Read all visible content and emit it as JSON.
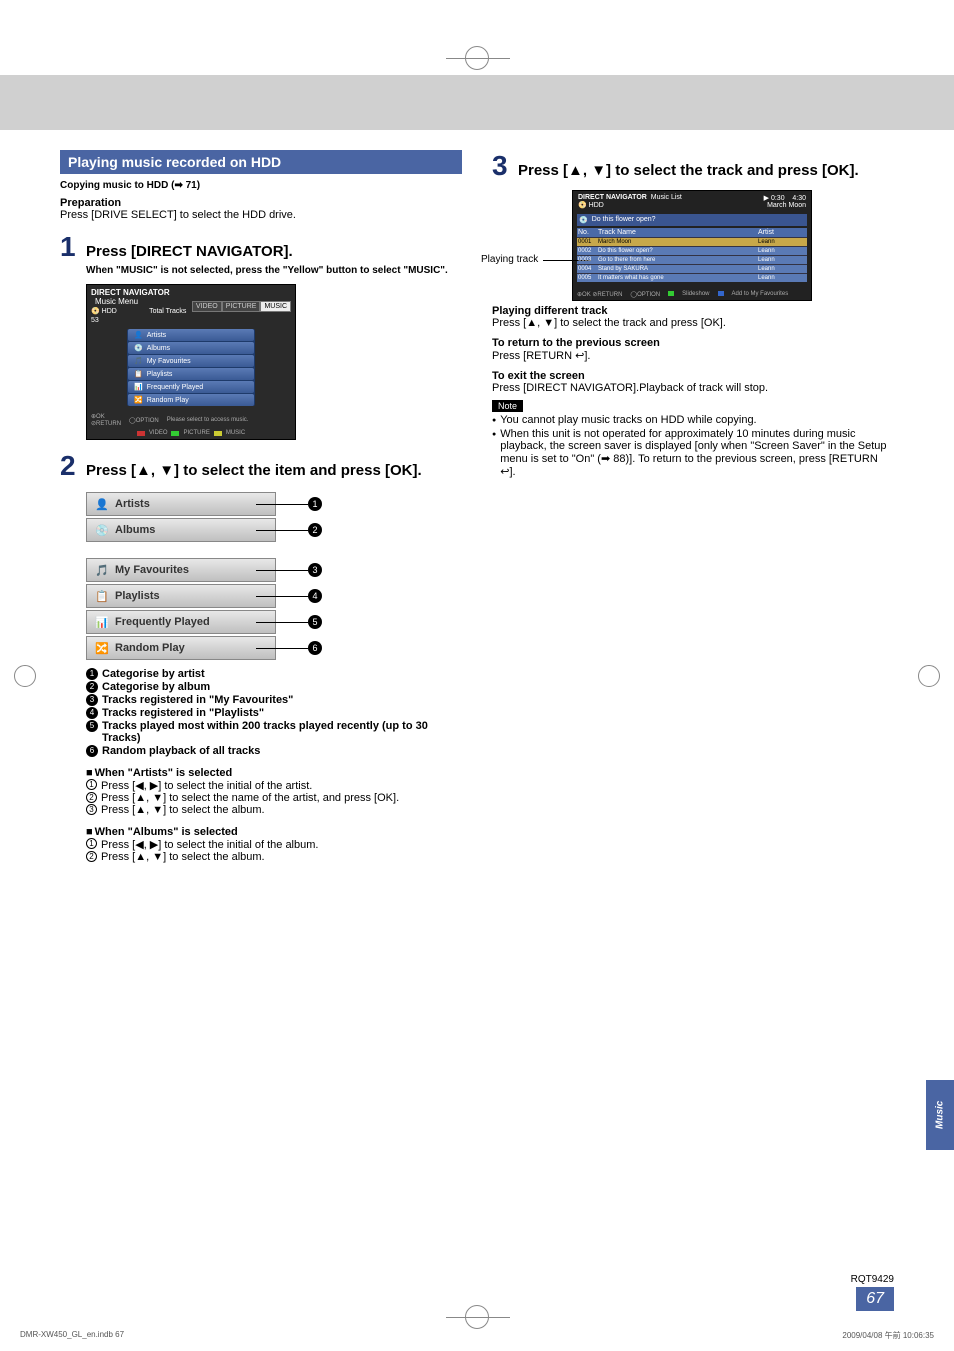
{
  "section_title": "Playing music recorded on HDD",
  "copying_line": "Copying music to HDD (➡ 71)",
  "prep_label": "Preparation",
  "prep_text": "Press [DRIVE SELECT] to select the HDD drive.",
  "step1": {
    "num": "1",
    "title": "Press [DIRECT NAVIGATOR].",
    "sub": "When \"MUSIC\" is not selected, press the \"Yellow\" button to select \"MUSIC\"."
  },
  "ss1": {
    "header_left": "DIRECT NAVIGATOR",
    "header_mid": "Music Menu",
    "hdd": "HDD",
    "total": "Total Tracks  53",
    "tabs": [
      "VIDEO",
      "PICTURE",
      "MUSIC"
    ],
    "items": [
      "Artists",
      "Albums",
      "My Favourites",
      "Playlists",
      "Frequently Played",
      "Random Play"
    ],
    "footer_ok": "OK",
    "footer_return": "RETURN",
    "footer_option": "OPTION",
    "footer_hint": "Please select to access music.",
    "footer_keys": [
      "VIDEO",
      "PICTURE",
      "MUSIC"
    ]
  },
  "step2": {
    "num": "2",
    "title": "Press [▲, ▼] to select the item and press [OK]."
  },
  "catlist": [
    "Artists",
    "Albums",
    "My Favourites",
    "Playlists",
    "Frequently Played",
    "Random Play"
  ],
  "callouts": [
    "1",
    "2",
    "3",
    "4",
    "5",
    "6"
  ],
  "legend": [
    "Categorise by artist",
    "Categorise by album",
    "Tracks registered in \"My Favourites\"",
    "Tracks registered in \"Playlists\"",
    "Tracks played most within 200 tracks played recently (up to 30 Tracks)",
    "Random playback of all tracks"
  ],
  "artists_head": "When \"Artists\" is selected",
  "artists_steps": [
    "Press [◀, ▶] to select the initial of the artist.",
    "Press [▲, ▼] to select the name of the artist, and press [OK].",
    "Press [▲, ▼] to select the album."
  ],
  "albums_head": "When \"Albums\" is selected",
  "albums_steps": [
    "Press [◀, ▶] to select the initial of the album.",
    "Press [▲, ▼] to select the album."
  ],
  "step3": {
    "num": "3",
    "title": "Press [▲, ▼] to select the track and press [OK]."
  },
  "ss3": {
    "header_left": "DIRECT NAVIGATOR",
    "header_mid": "Music List",
    "hdd": "HDD",
    "time": "▶ 0:30",
    "total": "4:30",
    "now": "March Moon",
    "album_icon": "💿",
    "album": "Do this flower open?",
    "th": [
      "No.",
      "Track Name",
      "Artist"
    ],
    "rows": [
      {
        "no": "0001",
        "name": "March Moon",
        "artist": "Leann"
      },
      {
        "no": "0002",
        "name": "Do this flower open?",
        "artist": "Leann"
      },
      {
        "no": "0003",
        "name": "Go to there from here",
        "artist": "Leann"
      },
      {
        "no": "0004",
        "name": "Stand by SAKURA",
        "artist": "Leann"
      },
      {
        "no": "0005",
        "name": "It matters what has gone",
        "artist": "Leann"
      }
    ],
    "footer_ok": "OK",
    "footer_return": "RETURN",
    "footer_option": "OPTION",
    "footer_slide": "Slideshow",
    "footer_add": "Add to My Favourites"
  },
  "playing_track_label": "Playing track",
  "pdt_head": "Playing different track",
  "pdt_text": "Press [▲, ▼] to select the track and press [OK].",
  "ret_head": "To return to the previous screen",
  "ret_text": "Press [RETURN ↩].",
  "exit_head": "To exit the screen",
  "exit_text": "Press [DIRECT NAVIGATOR].Playback of track will stop.",
  "note_label": "Note",
  "notes": [
    "You cannot play music tracks on HDD while copying.",
    "When this unit is not operated for approximately 10 minutes during music playback, the screen saver is displayed [only when \"Screen Saver\" in the Setup menu is set to \"On\" (➡ 88)]. To return to the previous screen, press [RETURN ↩]."
  ],
  "side_tab": "Music",
  "rqt": "RQT9429",
  "page_num": "67",
  "footer_left": "DMR-XW450_GL_en.indb   67",
  "footer_right": "2009/04/08   午前 10:06:35"
}
